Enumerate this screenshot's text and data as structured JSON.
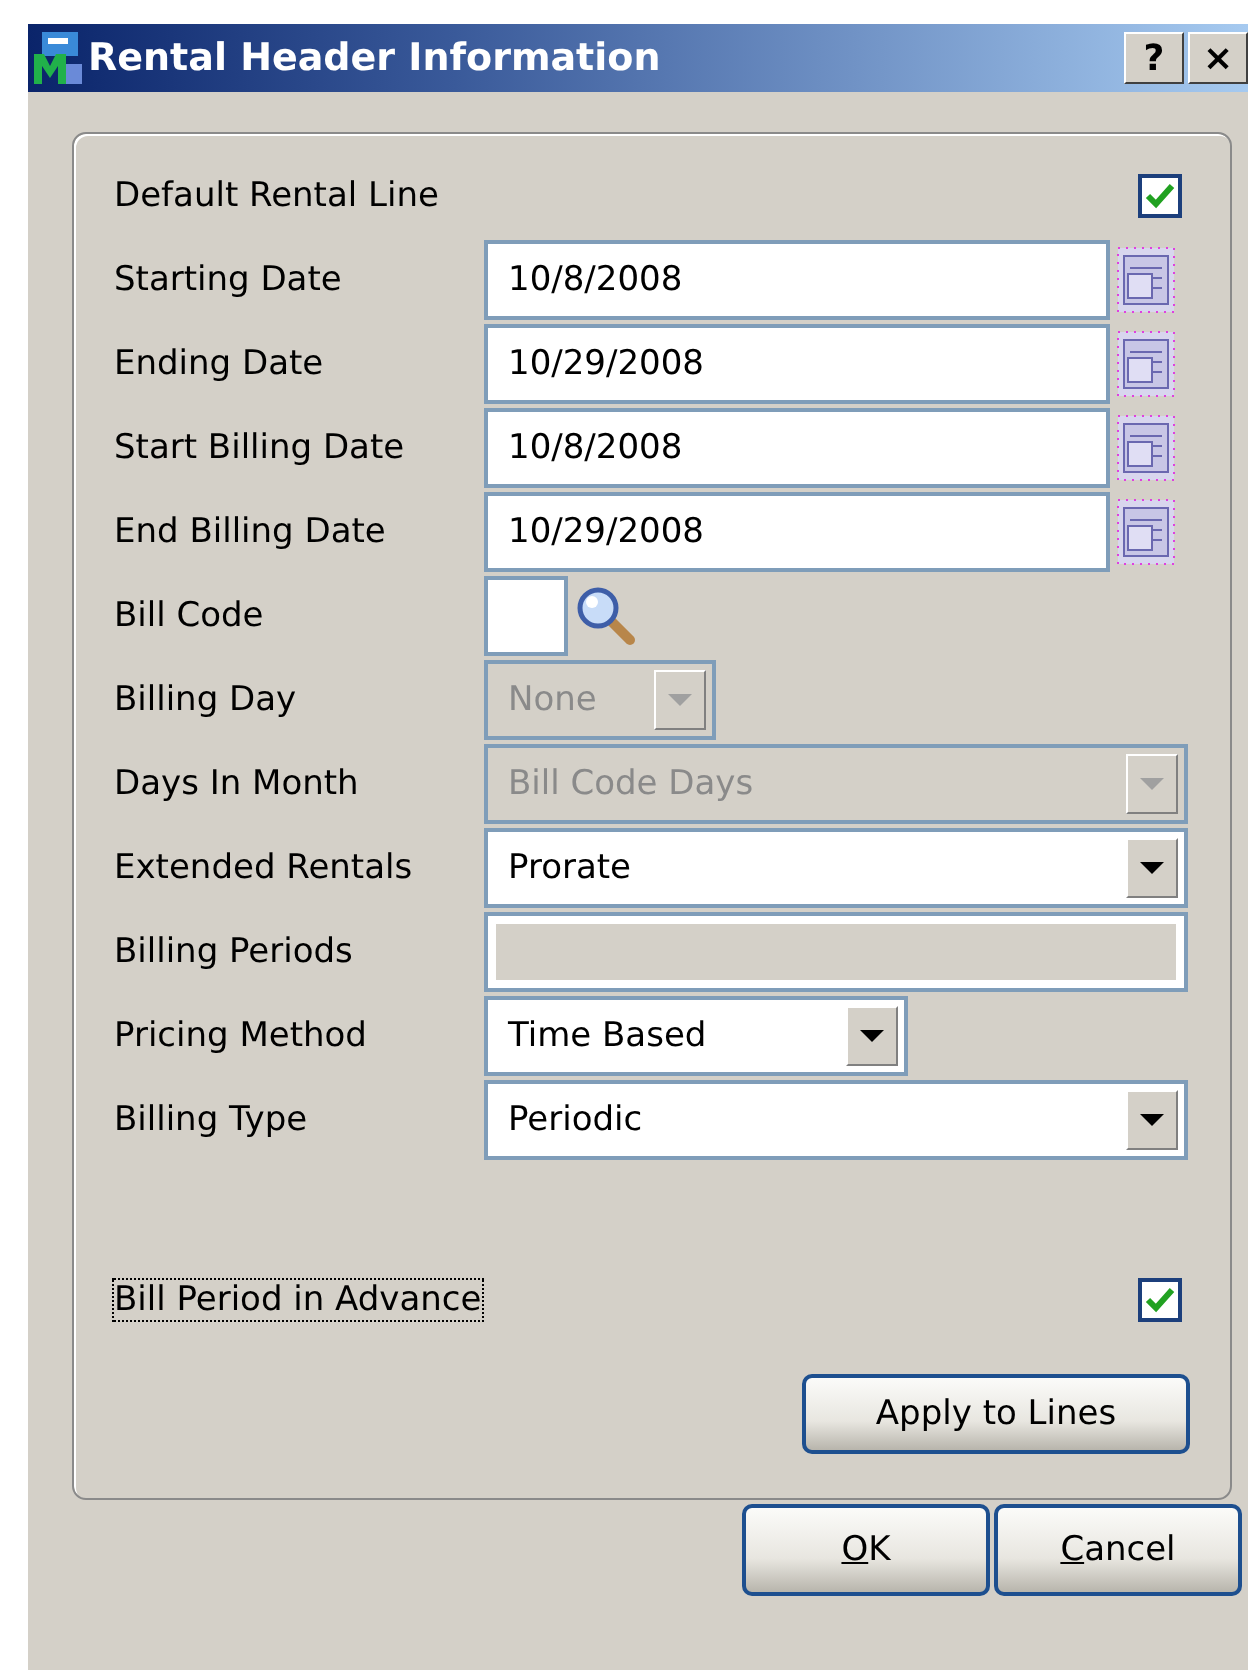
{
  "window": {
    "title": "Rental Header Information",
    "help_button": "?",
    "close_button": "×"
  },
  "rows": [
    {
      "kind": "checkbox",
      "label": "Default Rental Line",
      "checked": true
    },
    {
      "kind": "date",
      "label": "Starting Date",
      "value": "10/8/2008"
    },
    {
      "kind": "date",
      "label": "Ending Date",
      "value": "10/29/2008"
    },
    {
      "kind": "date",
      "label": "Start Billing Date",
      "value": "10/8/2008"
    },
    {
      "kind": "date",
      "label": "End Billing Date",
      "value": "10/29/2008"
    },
    {
      "kind": "lookup",
      "label": "Bill Code"
    },
    {
      "kind": "combo",
      "label": "Billing Day",
      "value": "None",
      "disabled": true
    },
    {
      "kind": "combo",
      "label": "Days In Month",
      "value": "Bill Code Days",
      "disabled": true
    },
    {
      "kind": "combo",
      "label": "Extended Rentals",
      "value": "Prorate",
      "disabled": false
    },
    {
      "kind": "text",
      "label": "Billing Periods",
      "disabled": true
    },
    {
      "kind": "combo",
      "label": "Pricing Method",
      "value": "Time Based",
      "disabled": false
    },
    {
      "kind": "combo",
      "label": "Billing Type",
      "value": "Periodic",
      "disabled": false
    }
  ],
  "advance": {
    "label": "Bill Period in Advance",
    "checked": true,
    "focused": true
  },
  "apply_button": "Apply to Lines",
  "buttons": [
    {
      "label": "OK",
      "underlined_first_letter": true
    },
    {
      "label": "Cancel",
      "underlined_first_letter": true
    }
  ]
}
